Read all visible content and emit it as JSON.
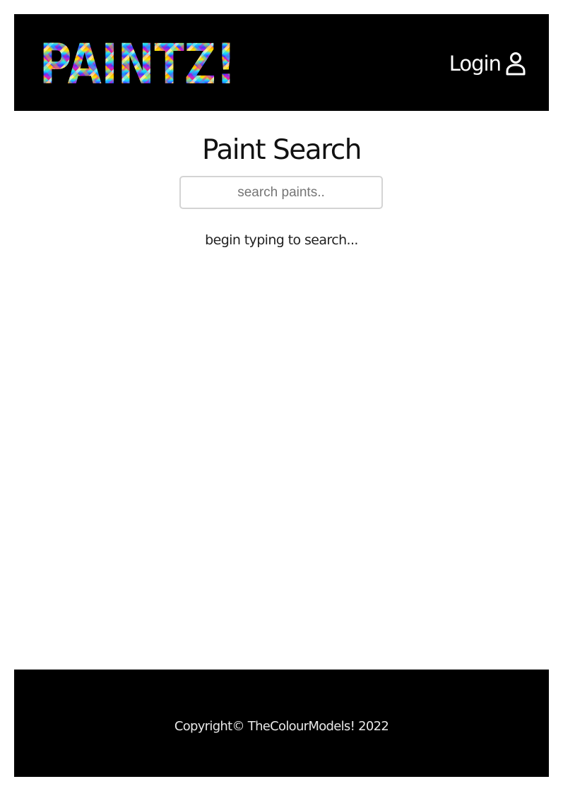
{
  "header": {
    "logo_text": "PAINTZ!",
    "login_label": "Login",
    "login_icon": "user-icon",
    "background": "#000000"
  },
  "main": {
    "title": "Paint Search",
    "search": {
      "placeholder": "search paints..",
      "value": ""
    },
    "hint": "begin typing to search..."
  },
  "footer": {
    "copyright": "Copyright© TheColourModels! 2022",
    "background": "#000000"
  }
}
